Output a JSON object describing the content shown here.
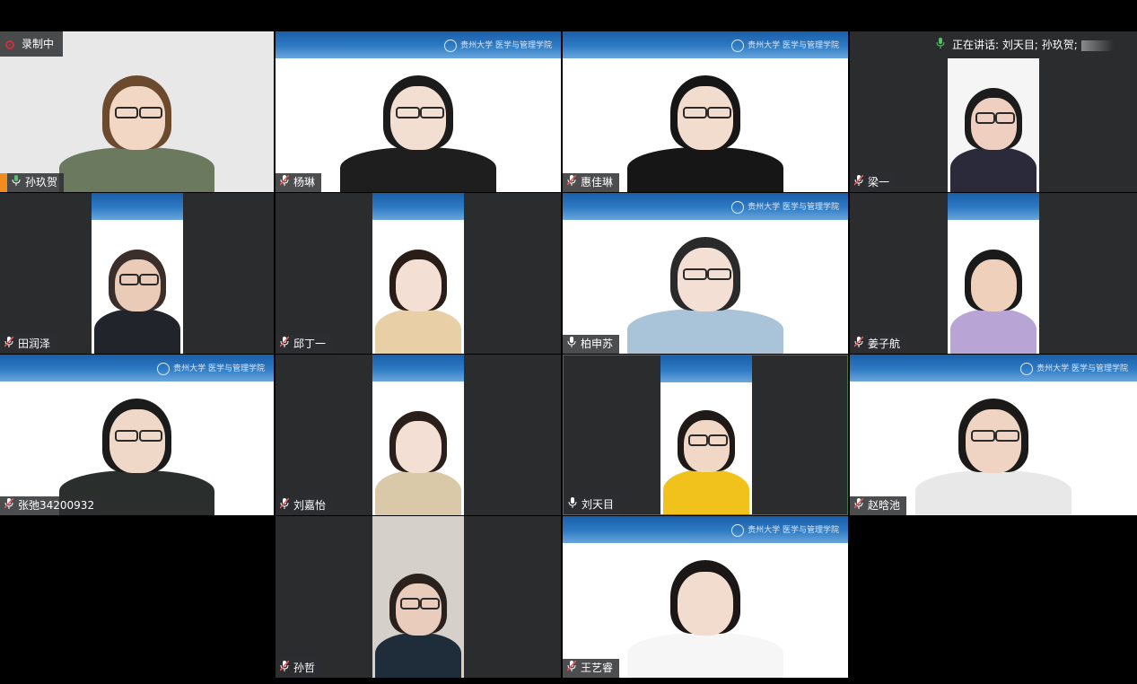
{
  "recording": {
    "label": "录制中"
  },
  "speaking": {
    "label": "正在讲话: 刘天目; 孙玖贺;"
  },
  "banner": {
    "logo_text": "贵州大学 医学与管理学院"
  },
  "participants": [
    {
      "name": "孙玖贺",
      "mic": "on",
      "video": "full",
      "banner": false,
      "bg": "#e8e8e8",
      "shirt": "#6b7a5e",
      "hair": "#6b4a2e",
      "skin": "#f1d7c4",
      "glasses": true,
      "host": true
    },
    {
      "name": "杨琳",
      "mic": "muted",
      "video": "full",
      "banner": true,
      "bg": "#ffffff",
      "shirt": "#1e1e1e",
      "hair": "#1b1b1b",
      "skin": "#f3dfd2",
      "glasses": true
    },
    {
      "name": "惠佳琳",
      "mic": "muted",
      "video": "full",
      "banner": true,
      "bg": "#ffffff",
      "shirt": "#161616",
      "hair": "#161616",
      "skin": "#f2dccd",
      "glasses": true
    },
    {
      "name": "梁一",
      "mic": "muted",
      "video": "portrait",
      "banner": false,
      "bg": "#f5f5f5",
      "shirt": "#2a2a3a",
      "hair": "#1c1c1c",
      "skin": "#efd0c0",
      "glasses": true
    },
    {
      "name": "田润泽",
      "mic": "muted",
      "video": "portrait",
      "banner": true,
      "bg": "#ffffff",
      "shirt": "#22242c",
      "hair": "#3a2f2a",
      "skin": "#e9cbb8",
      "glasses": true
    },
    {
      "name": "邱丁一",
      "mic": "muted",
      "video": "portrait",
      "banner": true,
      "bg": "#ffffff",
      "shirt": "#e9cfa5",
      "hair": "#2a1d17",
      "skin": "#f4dfd4",
      "glasses": false
    },
    {
      "name": "柏申苏",
      "mic": "plain",
      "video": "full",
      "banner": true,
      "bg": "#ffffff",
      "shirt": "#a9c4d8",
      "hair": "#2a2a2a",
      "skin": "#f3dfd4",
      "glasses": true
    },
    {
      "name": "姜子航",
      "mic": "muted",
      "video": "portrait",
      "banner": true,
      "bg": "#ffffff",
      "shirt": "#b9a4d6",
      "hair": "#1a1a1a",
      "skin": "#eed0bb",
      "glasses": false
    },
    {
      "name": "张弛34200932",
      "mic": "muted",
      "video": "full",
      "banner": true,
      "bg": "#ffffff",
      "shirt": "#2a2f2d",
      "hair": "#1b1b1b",
      "skin": "#f0d8c8",
      "glasses": true
    },
    {
      "name": "刘嘉怡",
      "mic": "muted",
      "video": "portrait",
      "banner": true,
      "bg": "#ffffff",
      "shirt": "#d9c9a8",
      "hair": "#2a1f1a",
      "skin": "#f4dfd4",
      "glasses": false
    },
    {
      "name": "刘天目",
      "mic": "plain",
      "video": "portrait",
      "banner": true,
      "bg": "#ffffff",
      "shirt": "#f1c21b",
      "hair": "#1f1a17",
      "skin": "#f1d8c6",
      "glasses": true,
      "active": true
    },
    {
      "name": "赵晗池",
      "mic": "muted",
      "video": "full",
      "banner": true,
      "bg": "#ffffff",
      "shirt": "#e8e8e8",
      "hair": "#1c1a19",
      "skin": "#f0d4c3",
      "glasses": true
    },
    {
      "name": "孙哲",
      "mic": "muted",
      "video": "portrait",
      "banner": false,
      "bg": "#d6d0cb",
      "shirt": "#1f2c3a",
      "hair": "#2a211c",
      "skin": "#e9ccbb",
      "glasses": true
    },
    {
      "name": "王艺睿",
      "mic": "muted",
      "video": "full",
      "banner": true,
      "bg": "#ffffff",
      "shirt": "#f6f6f6",
      "hair": "#1b1717",
      "skin": "#f2dccd",
      "glasses": false
    }
  ]
}
